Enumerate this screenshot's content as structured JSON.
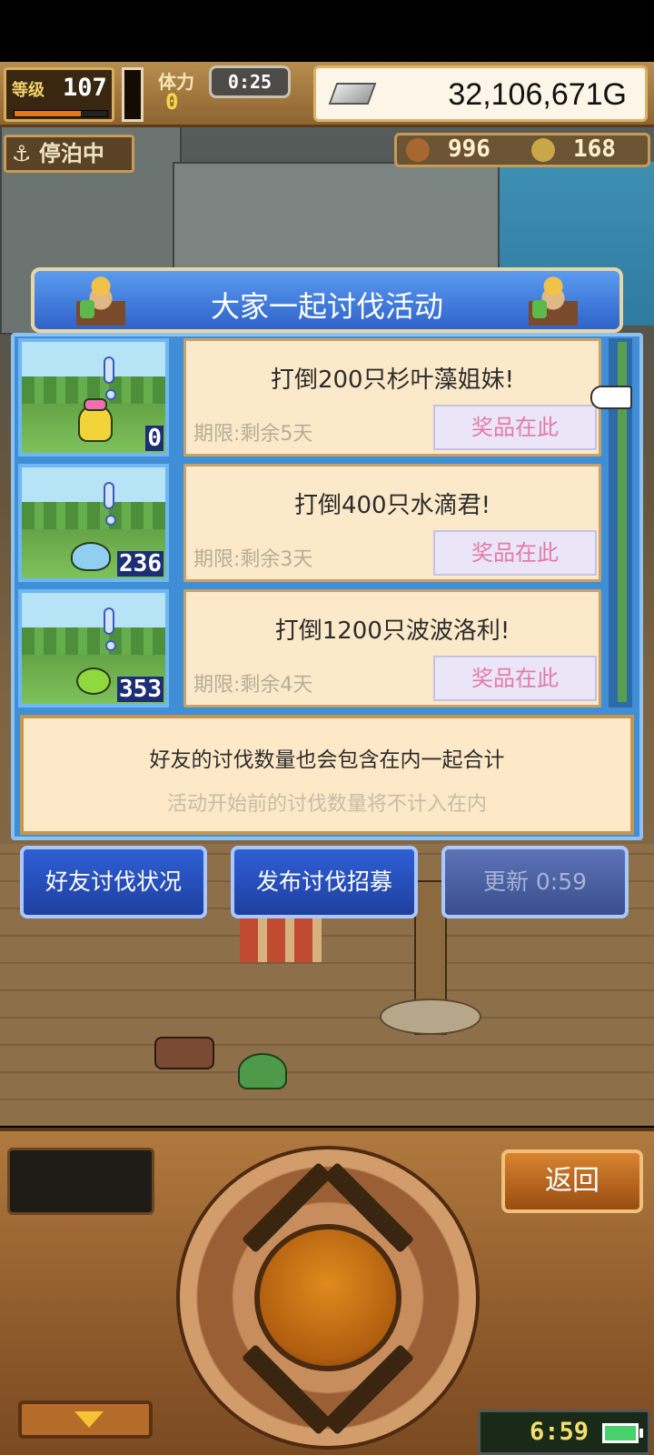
{
  "hud": {
    "level_label": "等级",
    "level": "107",
    "stamina_label": "体力",
    "stamina": "0",
    "timer": "0:25",
    "gold": "32,106,671G",
    "port_status": "停泊中",
    "resource_1": "996",
    "resource_2": "168"
  },
  "event": {
    "title": "大家一起讨伐活动",
    "quests": [
      {
        "title": "打倒200只杉叶藻姐妹!",
        "deadline": "期限:剩余5天",
        "reward": "奖品在此",
        "count": "0"
      },
      {
        "title": "打倒400只水滴君!",
        "deadline": "期限:剩余3天",
        "reward": "奖品在此",
        "count": "236"
      },
      {
        "title": "打倒1200只波波洛利!",
        "deadline": "期限:剩余4天",
        "reward": "奖品在此",
        "count": "353"
      }
    ],
    "note_main": "好友的讨伐数量也会包含在内一起合计",
    "note_sub": "活动开始前的讨伐数量将不计入在内",
    "buttons": {
      "friend_status": "好友讨伐状况",
      "post_recruit": "发布讨伐招募",
      "refresh": "更新 0:59"
    }
  },
  "controls": {
    "back": "返回",
    "clock": "6:59"
  },
  "colors": {
    "panel_blue": "#3f8ed6",
    "reward_text": "#e57aa8",
    "card_bg": "#fbe9c9"
  }
}
